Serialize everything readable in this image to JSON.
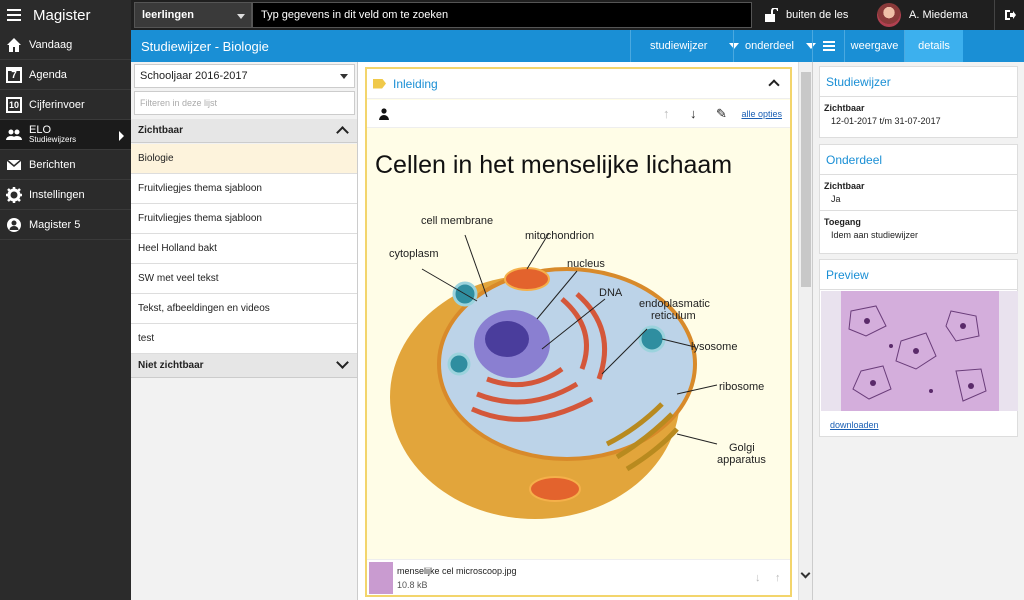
{
  "app": {
    "title": "Magister"
  },
  "search": {
    "scope": "leerlingen",
    "placeholder": "Typ gegevens in dit veld om te zoeken"
  },
  "lessons_button": "buiten de les",
  "user": {
    "name": "A. Miedema"
  },
  "sidebar": {
    "items": [
      {
        "label": "Vandaag",
        "icon": "home-icon"
      },
      {
        "label": "Agenda",
        "icon": "calendar-icon",
        "icon_text": "7"
      },
      {
        "label": "Cijferinvoer",
        "icon": "grades-icon",
        "icon_text": "10"
      },
      {
        "label": "ELO",
        "sub": "Studiewijzers",
        "icon": "people-icon",
        "active": true
      },
      {
        "label": "Berichten",
        "icon": "envelope-icon"
      },
      {
        "label": "Instellingen",
        "icon": "gear-icon"
      },
      {
        "label": "Magister 5",
        "icon": "magister-icon"
      }
    ]
  },
  "header": {
    "title": "Studiewijzer - Biologie",
    "buttons": {
      "studiewijzer": "studiewijzer",
      "onderdeel": "onderdeel",
      "weergave": "weergave",
      "details": "details"
    }
  },
  "list": {
    "year": "Schooljaar 2016-2017",
    "filter_placeholder": "Filteren in deze lijst",
    "group_visible": "Zichtbaar",
    "items": [
      "Biologie",
      "Fruitvliegjes thema sjabloon",
      "Fruitvliegjes thema sjabloon",
      "Heel Holland bakt",
      "SW met veel tekst",
      "Tekst, afbeeldingen en videos",
      "test"
    ],
    "group_hidden": "Niet zichtbaar"
  },
  "content": {
    "section": "Inleiding",
    "all_options": "alle opties",
    "heading": "Cellen in het menselijke lichaam",
    "diagram_labels": {
      "cell_membrane": "cell membrane",
      "mitochondrion": "mitochondrion",
      "cytoplasm": "cytoplasm",
      "nucleus": "nucleus",
      "dna": "DNA",
      "er": "endoplasmatic",
      "er2": "reticulum",
      "lysosome": "lysosome",
      "ribosome": "ribosome",
      "golgi": "Golgi",
      "golgi2": "apparatus"
    },
    "attachment": {
      "name": "menselijke cel microscoop.jpg",
      "size": "10.8 kB"
    }
  },
  "details": {
    "studiewijzer": {
      "title": "Studiewijzer",
      "label": "Zichtbaar",
      "value": "12-01-2017 t/m 31-07-2017"
    },
    "onderdeel": {
      "title": "Onderdeel",
      "label1": "Zichtbaar",
      "value1": "Ja",
      "label2": "Toegang",
      "value2": "Idem aan studiewijzer"
    },
    "preview": {
      "title": "Preview",
      "download": "downloaden"
    }
  },
  "colors": {
    "accent": "#1a8fd5",
    "sidebar": "#2b2b2b",
    "card_border": "#f3d56c"
  }
}
